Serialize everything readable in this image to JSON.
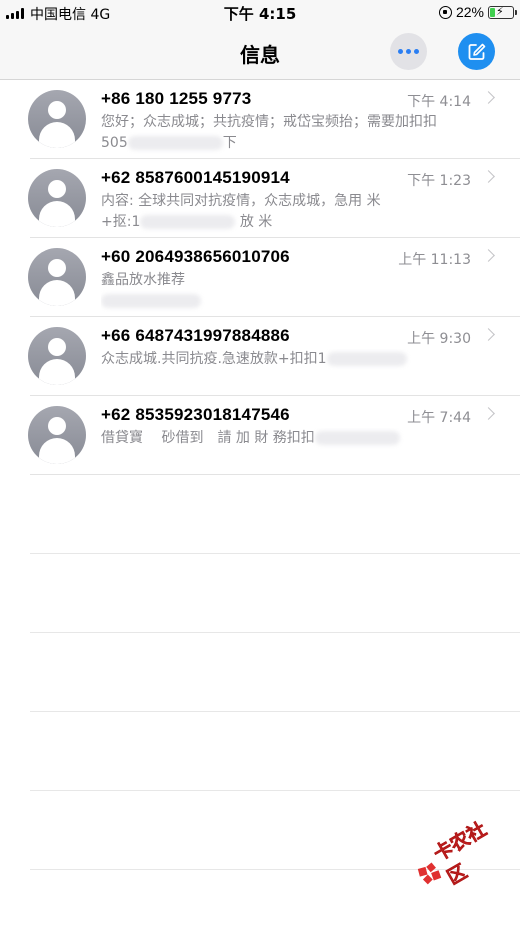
{
  "status_bar": {
    "carrier": "中国电信  4G",
    "time": "下午 4:15",
    "battery_percent": "22%",
    "battery_level": 0.22,
    "icons": [
      "signal-icon",
      "rotation-lock-icon",
      "battery-charging-icon"
    ]
  },
  "nav": {
    "title": "信息",
    "more_icon": "ellipsis-icon",
    "compose_icon": "compose-icon",
    "accent_color": "#1f8ff0"
  },
  "messages": [
    {
      "sender": "+86 180 1255 9773",
      "time": "下午 4:14",
      "preview_line1": "您好；众志成城；共抗疫情；戒岱宝频抬；需要加扣扣",
      "preview_line2_start": "505",
      "preview_line2_end": "下"
    },
    {
      "sender": "+62 8587600145190914",
      "time": "下午 1:23",
      "preview_line1": "内容: 全球共同对抗疫情，众志成城，急用 米",
      "preview_line2_start": "+抠:1",
      "preview_line2_end": "放 米"
    },
    {
      "sender": "+60 2064938656010706",
      "time": "上午 11:13",
      "preview_line1": "鑫品放水推荐",
      "preview_line2_start": "",
      "preview_line2_end": ""
    },
    {
      "sender": "+66 6487431997884886",
      "time": "上午 9:30",
      "preview_line1": "众志成城.共同抗疫.急速放款+扣扣1",
      "preview_line2_start": "",
      "preview_line2_end": ""
    },
    {
      "sender": "+62 8535923018147546",
      "time": "上午 7:44",
      "preview_line1": "借貸寶　 砂借到　請 加 財 務扣扣",
      "preview_line2_start": "",
      "preview_line2_end": ""
    }
  ],
  "watermark": {
    "text": "卡农社区",
    "color": "#e03030"
  }
}
